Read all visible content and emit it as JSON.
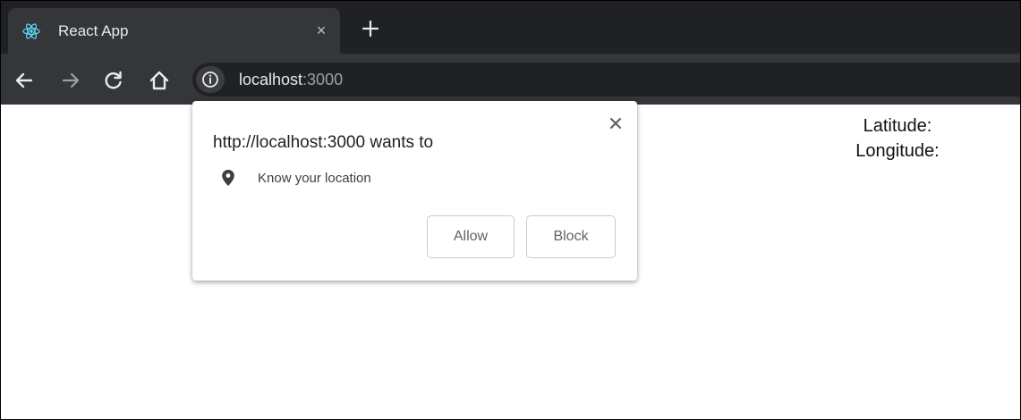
{
  "browser": {
    "tab": {
      "title": "React App",
      "icon": "react-logo-icon",
      "close_glyph": "×"
    },
    "new_tab_icon": "plus-icon",
    "toolbar": {
      "back_icon": "arrow-left-icon",
      "forward_icon": "arrow-right-icon",
      "reload_icon": "reload-icon",
      "home_icon": "home-icon",
      "site_info_icon": "info-icon"
    },
    "address": {
      "host": "localhost",
      "port": ":3000"
    }
  },
  "permission_prompt": {
    "title": "http://localhost:3000 wants to",
    "permission_icon": "location-pin-icon",
    "permission_label": "Know your location",
    "allow_label": "Allow",
    "block_label": "Block",
    "close_icon": "close-icon"
  },
  "page": {
    "latitude_label": "Latitude:",
    "longitude_label": "Longitude:"
  },
  "colors": {
    "tab_strip": "#202124",
    "toolbar": "#35363a",
    "react_logo": "#61dafb"
  }
}
